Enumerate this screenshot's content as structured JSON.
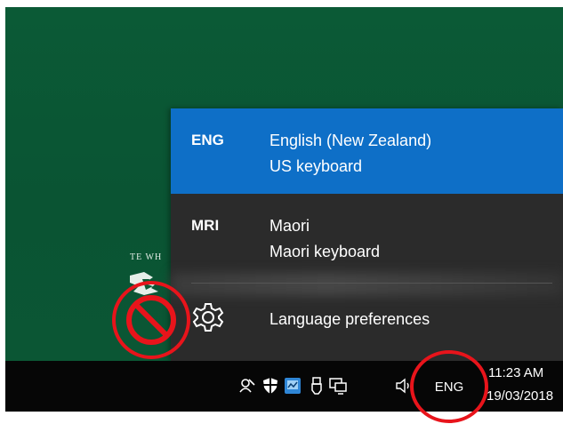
{
  "desktop": {
    "logo_text": "TE WH"
  },
  "flyout": {
    "languages": [
      {
        "code": "ENG",
        "name": "English (New Zealand)",
        "layout": "US keyboard",
        "selected": true
      },
      {
        "code": "MRI",
        "name": "Maori",
        "layout": "Maori keyboard",
        "selected": false
      }
    ],
    "preferences": {
      "label": "Language preferences",
      "icon": "gear-icon"
    }
  },
  "taskbar": {
    "tray_icons": [
      "people-icon",
      "shield-icon",
      "network-monitor-icon",
      "usb-icon",
      "network-icon",
      "volume-icon"
    ],
    "ime_indicator": "ENG",
    "clock": {
      "time": "11:23 AM",
      "date": "19/03/2018"
    }
  },
  "colors": {
    "desktop": "#0b5a36",
    "flyout_bg": "#2b2b2b",
    "selection": "#0e6fc7",
    "taskbar": "#060606",
    "annotation": "#e8141b"
  }
}
